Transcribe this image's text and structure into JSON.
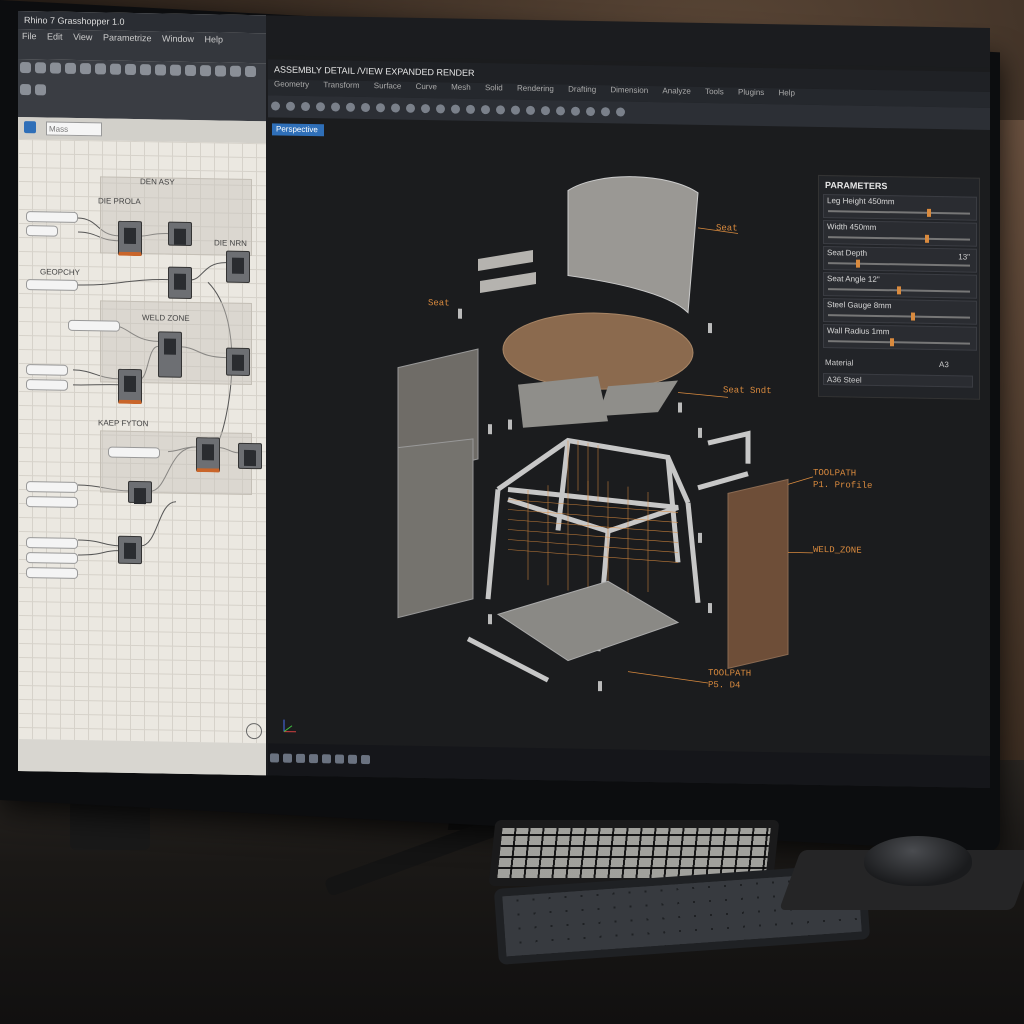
{
  "left_app": {
    "title": "Rhino 7 Grasshopper 1.0",
    "menu": [
      "File",
      "Edit",
      "View",
      "Parametrize",
      "Window",
      "Help"
    ],
    "search_placeholder": "Mass",
    "groups": [
      {
        "label": "DEN ASY"
      },
      {
        "label": "DIE PROLA"
      },
      {
        "label": "DIE NRN"
      },
      {
        "label": "GEOPCHY"
      },
      {
        "label": "WELD ZONE"
      },
      {
        "label": "KAEP FYTON"
      }
    ]
  },
  "viewport": {
    "title": "ASSEMBLY DETAIL /VIEW EXPANDED RENDER",
    "tabs": [
      "Geometry",
      "Transform",
      "Surface",
      "Curve",
      "Mesh",
      "Solid",
      "Rendering",
      "Drafting",
      "Dimension",
      "Analyze",
      "Tools",
      "Plugins",
      "Help"
    ],
    "active_view": "Perspective",
    "annotations": {
      "seat": "Seat",
      "seat_support": "Seat Sndt",
      "seat_left": "Seat",
      "toolpath1": "TOOLPATH",
      "toolpath1_sub": "P1. Profile",
      "weld_zone": "WELD_ZONE",
      "toolpath2": "TOOLPATH",
      "toolpath2_sub": "P5. D4"
    }
  },
  "parameters": {
    "title": "PARAMETERS",
    "items": [
      {
        "label": "Leg Height 450mm",
        "fraction": 0.72,
        "value": ""
      },
      {
        "label": "Width 450mm",
        "fraction": 0.7,
        "value": ""
      },
      {
        "label": "Seat Depth",
        "fraction": 0.2,
        "value": "13\""
      },
      {
        "label": "Seat Angle 12\"",
        "fraction": 0.5,
        "value": ""
      },
      {
        "label": "Steel Gauge 8mm",
        "fraction": 0.6,
        "value": ""
      },
      {
        "label": "Wall Radius 1mm",
        "fraction": 0.45,
        "value": ""
      }
    ],
    "material_label": "Material",
    "material_value": "A3",
    "material_selected": "A36 Steel"
  },
  "colors": {
    "accent": "#d98a3e",
    "active_tab": "#2f6fb8",
    "panel_bg": "#222428"
  }
}
